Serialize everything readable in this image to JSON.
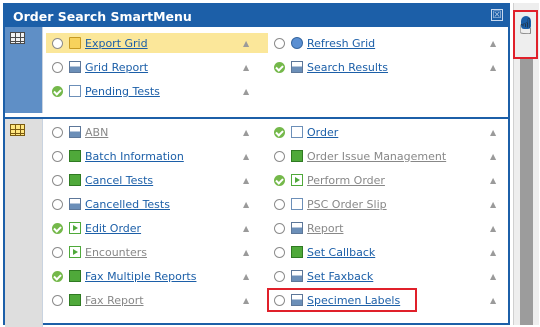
{
  "panel": {
    "title": "Order Search SmartMenu",
    "close_glyph": "☒"
  },
  "pin_glyph": "▲",
  "cursor_glyph": "☝",
  "section1": {
    "icon": "grid-icon",
    "items": [
      {
        "label": "Export Grid",
        "state": "radio",
        "icon": "folder-icon"
      },
      {
        "label": "Refresh Grid",
        "state": "radio",
        "icon": "refresh-icon"
      },
      {
        "label": "Grid Report",
        "state": "radio",
        "icon": "printer-icon"
      },
      {
        "label": "Search Results",
        "state": "checked",
        "icon": "printer-icon"
      },
      {
        "label": "Pending Tests",
        "state": "checked",
        "icon": "document-icon"
      }
    ]
  },
  "section2": {
    "icon": "grid-icon",
    "items": [
      {
        "label": "ABN",
        "state": "radio",
        "icon": "printer-icon"
      },
      {
        "label": "Order",
        "state": "checked",
        "icon": "document-icon"
      },
      {
        "label": "Batch Information",
        "state": "radio",
        "icon": "green-doc-icon"
      },
      {
        "label": "Order Issue Management",
        "state": "radio",
        "icon": "green-doc-icon"
      },
      {
        "label": "Cancel Tests",
        "state": "radio",
        "icon": "green-doc-icon"
      },
      {
        "label": "Perform Order",
        "state": "checked",
        "icon": "arrow-icon"
      },
      {
        "label": "Cancelled Tests",
        "state": "radio",
        "icon": "printer-icon"
      },
      {
        "label": "PSC Order Slip",
        "state": "radio",
        "icon": "document-icon"
      },
      {
        "label": "Edit Order",
        "state": "checked",
        "icon": "arrow-icon"
      },
      {
        "label": "Report",
        "state": "radio",
        "icon": "printer-icon"
      },
      {
        "label": "Encounters",
        "state": "radio",
        "icon": "arrow-icon"
      },
      {
        "label": "Set Callback",
        "state": "radio",
        "icon": "green-doc-icon"
      },
      {
        "label": "Fax Multiple Reports",
        "state": "checked",
        "icon": "green-doc-icon"
      },
      {
        "label": "Set Faxback",
        "state": "radio",
        "icon": "printer-icon"
      },
      {
        "label": "Fax Report",
        "state": "radio",
        "icon": "green-doc-icon"
      },
      {
        "label": "Specimen Labels",
        "state": "radio",
        "icon": "printer-icon"
      }
    ]
  },
  "colors": {
    "header": "#1c5fa8",
    "highlight": "#fbe79a",
    "focus_box": "#e0202a",
    "check": "#74b84a"
  }
}
